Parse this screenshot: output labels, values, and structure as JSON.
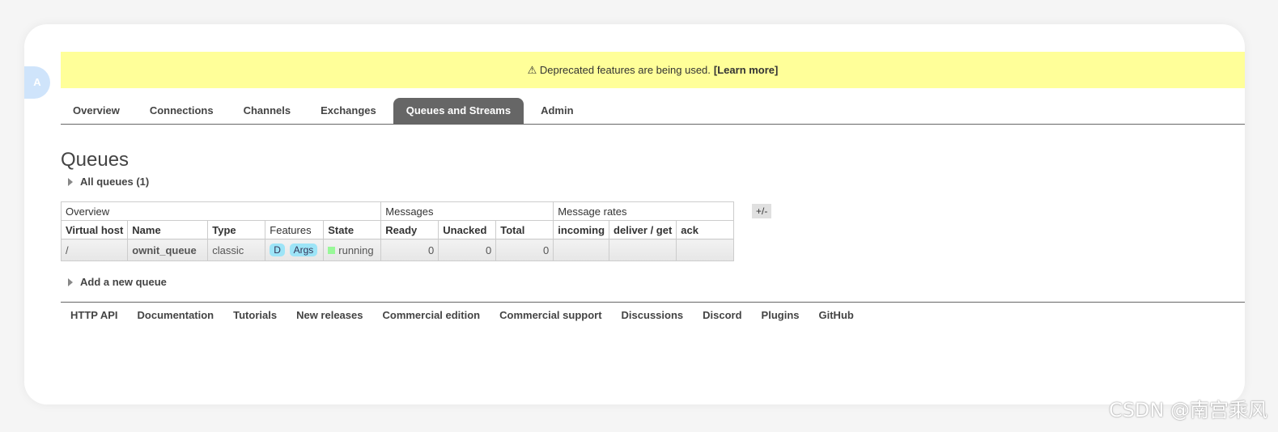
{
  "avatar": {
    "text": "A"
  },
  "banner": {
    "icon": "warning-icon",
    "text": "⚠ Deprecated features are being used.",
    "link": "[Learn more]"
  },
  "tabs": [
    {
      "label": "Overview",
      "active": false
    },
    {
      "label": "Connections",
      "active": false
    },
    {
      "label": "Channels",
      "active": false
    },
    {
      "label": "Exchanges",
      "active": false
    },
    {
      "label": "Queues and Streams",
      "active": true
    },
    {
      "label": "Admin",
      "active": false
    }
  ],
  "page": {
    "title": "Queues",
    "all_queues": "All queues (1)",
    "add_queue": "Add a new queue"
  },
  "table": {
    "groups": [
      "Overview",
      "Messages",
      "Message rates"
    ],
    "plus_minus": "+/-",
    "columns": [
      "Virtual host",
      "Name",
      "Type",
      "Features",
      "State",
      "Ready",
      "Unacked",
      "Total",
      "incoming",
      "deliver / get",
      "ack"
    ],
    "rows": [
      {
        "vhost": "/",
        "name": "ownit_queue",
        "type": "classic",
        "features": [
          "D",
          "Args"
        ],
        "state": "running",
        "ready": "0",
        "unacked": "0",
        "total": "0",
        "incoming": "",
        "deliver_get": "",
        "ack": ""
      }
    ]
  },
  "footer": {
    "links": [
      "HTTP API",
      "Documentation",
      "Tutorials",
      "New releases",
      "Commercial edition",
      "Commercial support",
      "Discussions",
      "Discord",
      "Plugins",
      "GitHub"
    ]
  },
  "watermark": "CSDN @南宫乘风",
  "colors": {
    "banner_bg": "#ffff99",
    "active_tab_bg": "#666666",
    "feature_pill": "#9de4f7",
    "running_dot": "#98f898"
  }
}
